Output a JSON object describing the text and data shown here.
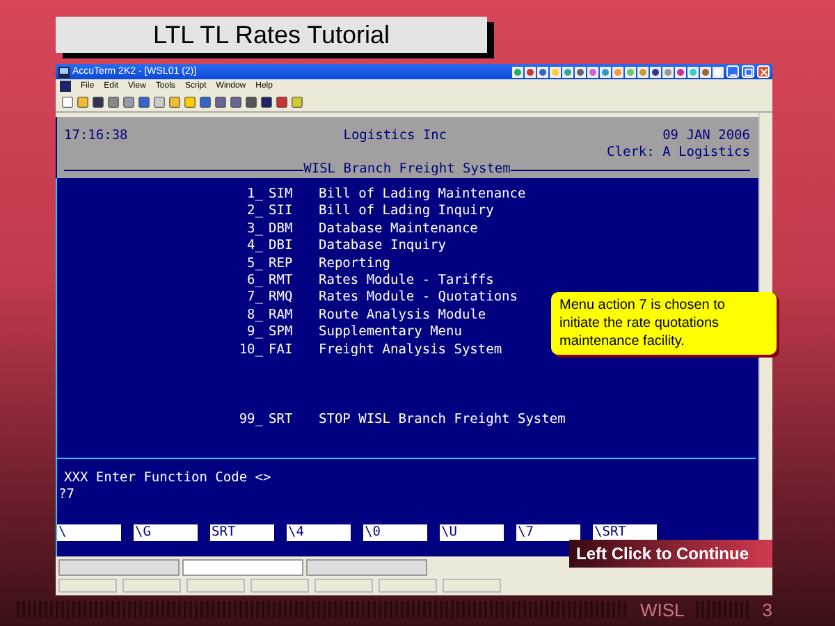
{
  "slide": {
    "title": "LTL TL Rates Tutorial",
    "footer": [
      "WISL",
      "3"
    ]
  },
  "window": {
    "title": "AccuTerm 2K2 - [WSL01 (2)]",
    "menu": [
      "File",
      "Edit",
      "View",
      "Tools",
      "Script",
      "Window",
      "Help"
    ]
  },
  "terminal": {
    "time": "17:16:38",
    "company": "Logistics Inc",
    "date": "09 JAN 2006",
    "clerk": "Clerk: A Logistics",
    "system": "WISL Branch Freight System",
    "menu_items": [
      {
        "number": "1_",
        "code": "SIM",
        "label": "Bill of Lading Maintenance"
      },
      {
        "number": "2_",
        "code": "SII",
        "label": "Bill of Lading Inquiry"
      },
      {
        "number": "3_",
        "code": "DBM",
        "label": "Database Maintenance"
      },
      {
        "number": "4_",
        "code": "DBI",
        "label": "Database Inquiry"
      },
      {
        "number": "5_",
        "code": "REP",
        "label": "Reporting"
      },
      {
        "number": "6_",
        "code": "RMT",
        "label": "Rates Module - Tariffs"
      },
      {
        "number": "7_",
        "code": "RMQ",
        "label": "Rates Module - Quotations"
      },
      {
        "number": "8_",
        "code": "RAM",
        "label": "Route Analysis Module"
      },
      {
        "number": "9_",
        "code": "SPM",
        "label": "Supplementary Menu"
      },
      {
        "number": "10_",
        "code": "FAI",
        "label": "Freight Analysis System"
      }
    ],
    "exit_item": {
      "number": "99_",
      "code": "SRT",
      "label": "STOP WISL Branch Freight System"
    },
    "prompt": "XXX Enter Function Code <>",
    "input": "?7",
    "function_keys": [
      "\\",
      "\\G",
      "SRT",
      "\\4",
      "\\0",
      "\\U",
      "\\7",
      "\\SRT"
    ]
  },
  "callout": {
    "text": "Menu action 7 is chosen to initiate the rate quotations maintenance facility."
  },
  "continue_button": "Left Click to Continue"
}
